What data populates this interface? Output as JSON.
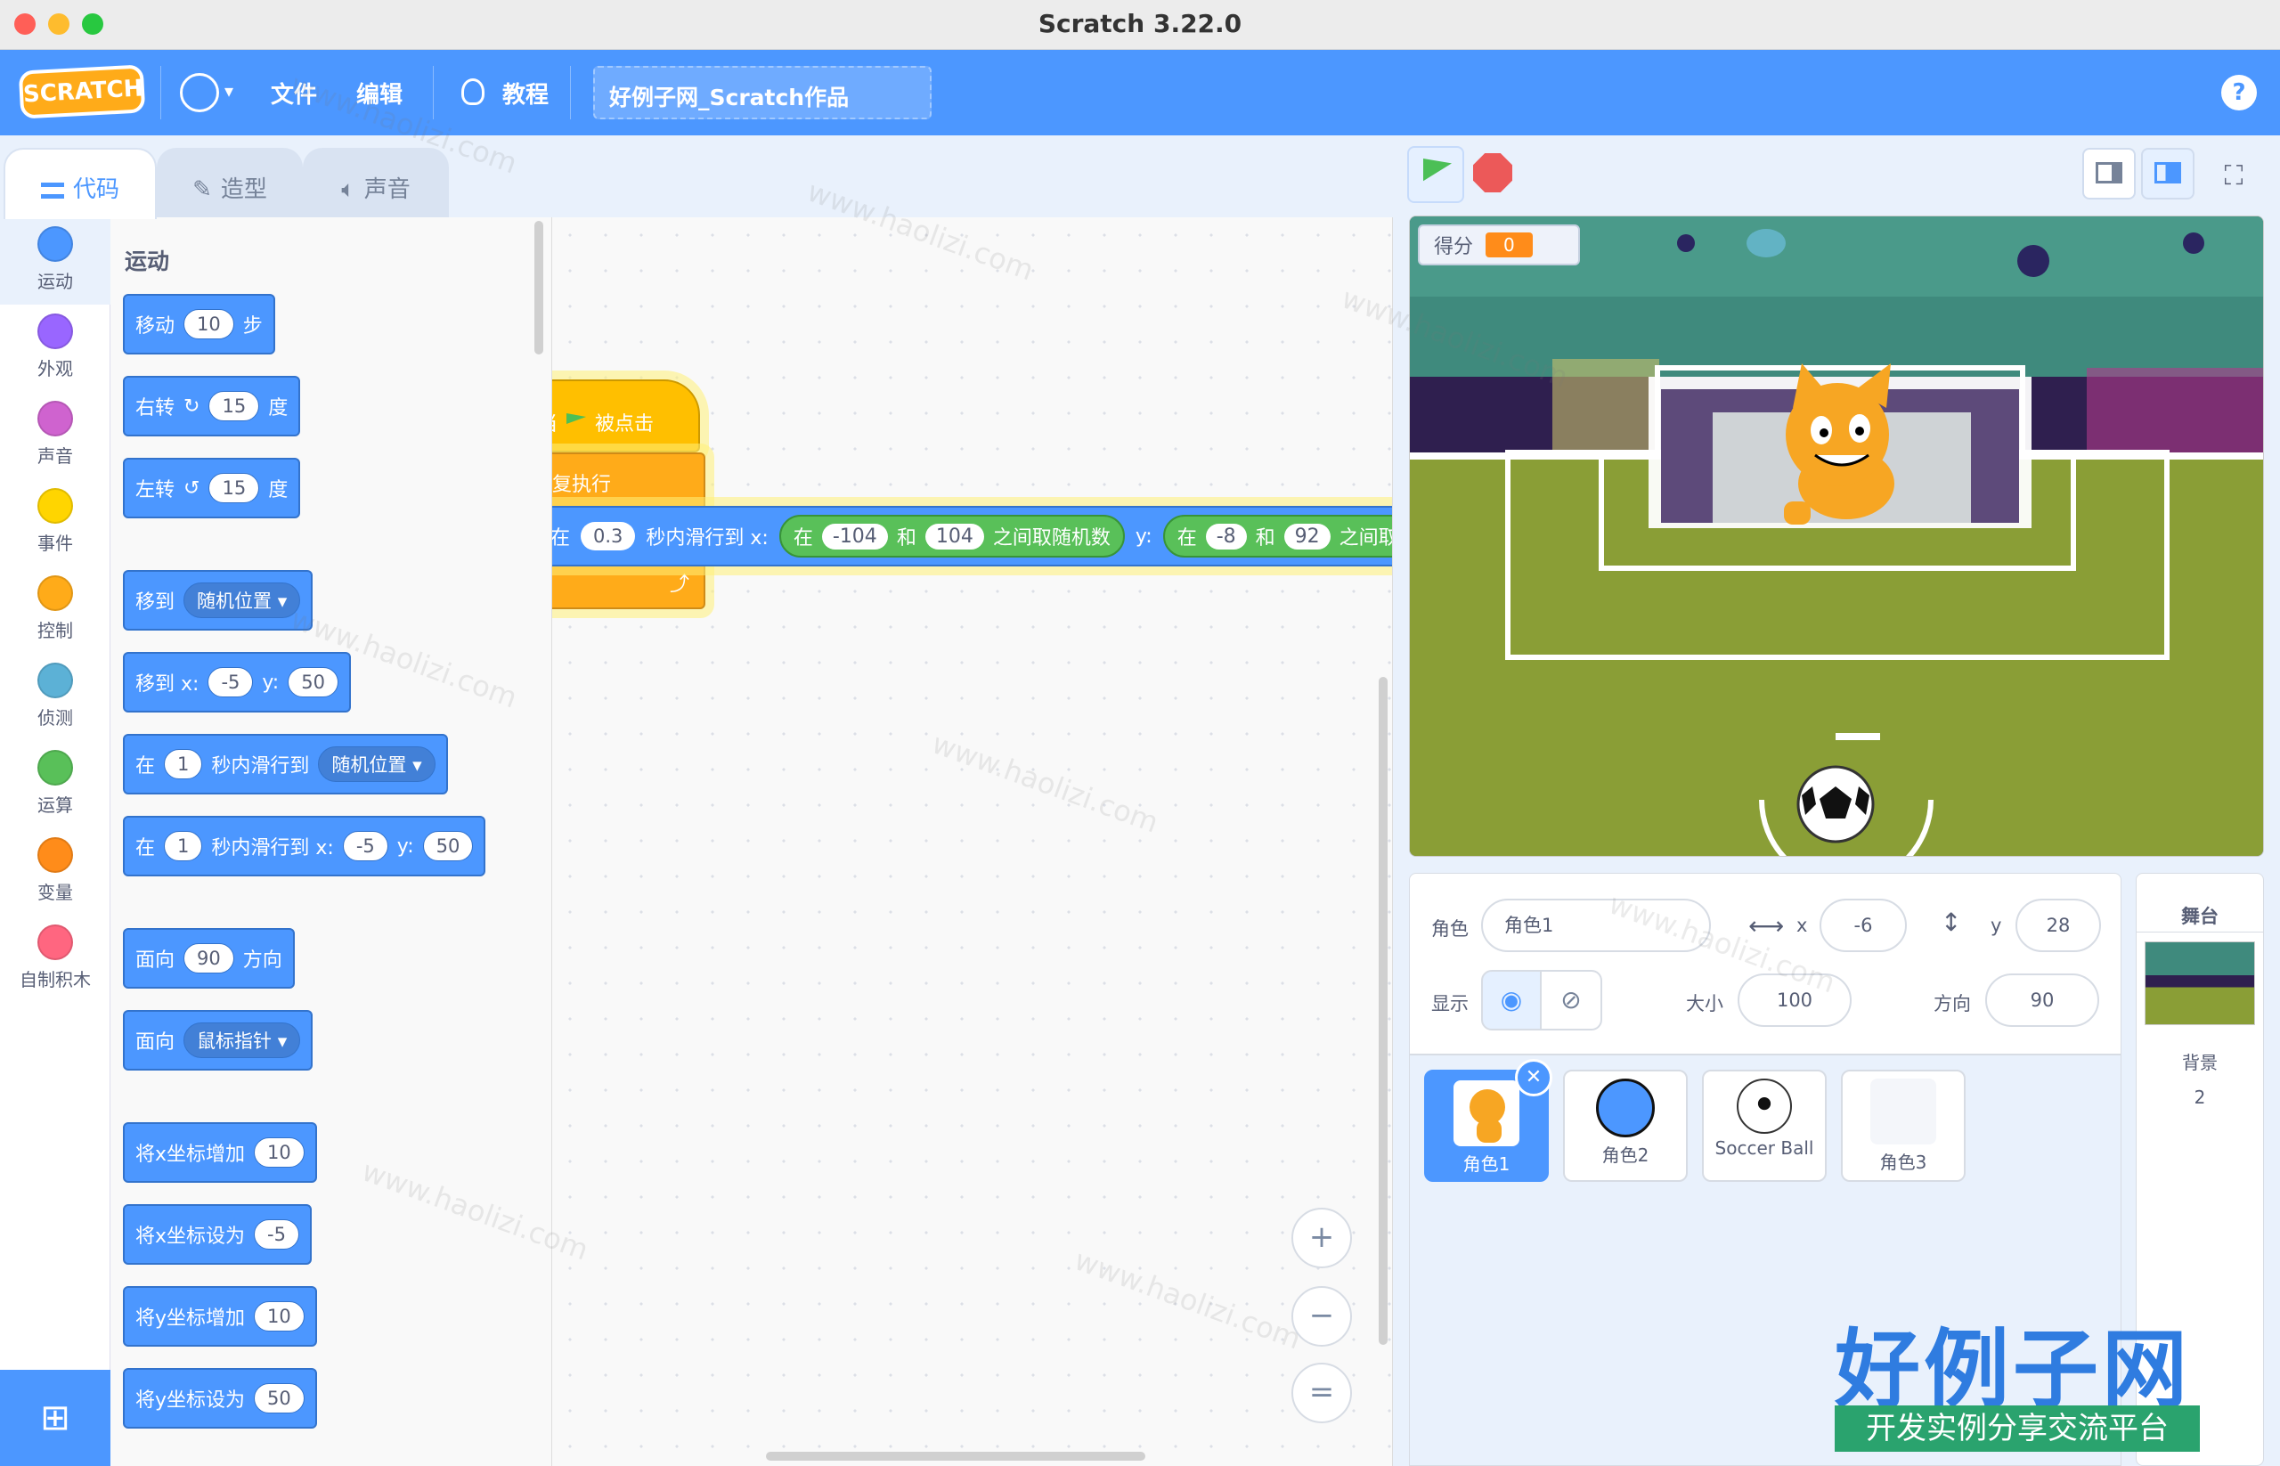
{
  "window": {
    "title": "Scratch 3.22.0"
  },
  "menubar": {
    "logo": "SCRATCH",
    "file": "文件",
    "edit": "编辑",
    "tutorials": "教程",
    "project_title": "好例子网_Scratch作品",
    "help": "?"
  },
  "tabs": {
    "code": "代码",
    "costumes": "造型",
    "sounds": "声音"
  },
  "categories": [
    {
      "label": "运动",
      "color": "#4c97ff"
    },
    {
      "label": "外观",
      "color": "#9966ff"
    },
    {
      "label": "声音",
      "color": "#cf63cf"
    },
    {
      "label": "事件",
      "color": "#ffd500"
    },
    {
      "label": "控制",
      "color": "#ffab19"
    },
    {
      "label": "侦测",
      "color": "#5cb1d6"
    },
    {
      "label": "运算",
      "color": "#59c059"
    },
    {
      "label": "变量",
      "color": "#ff8c1a"
    },
    {
      "label": "自制积木",
      "color": "#ff6680"
    }
  ],
  "palette": {
    "heading": "运动",
    "blocks": {
      "move": {
        "pre": "移动",
        "val": "10",
        "post": "步"
      },
      "turn_right": {
        "pre": "右转",
        "icon": "↻",
        "val": "15",
        "post": "度"
      },
      "turn_left": {
        "pre": "左转",
        "icon": "↺",
        "val": "15",
        "post": "度"
      },
      "goto": {
        "pre": "移到",
        "dd": "随机位置 ▾"
      },
      "goto_xy": {
        "pre": "移到 x:",
        "x": "-5",
        "ylabel": "y:",
        "y": "50"
      },
      "glide": {
        "pre": "在",
        "val": "1",
        "mid": "秒内滑行到",
        "dd": "随机位置 ▾"
      },
      "glide_xy": {
        "pre": "在",
        "val": "1",
        "mid": "秒内滑行到 x:",
        "x": "-5",
        "ylabel": "y:",
        "y": "50"
      },
      "point_dir": {
        "pre": "面向",
        "val": "90",
        "post": "方向"
      },
      "point_towards": {
        "pre": "面向",
        "dd": "鼠标指针 ▾"
      },
      "change_x": {
        "pre": "将x坐标增加",
        "val": "10"
      },
      "set_x": {
        "pre": "将x坐标设为",
        "val": "-5"
      },
      "change_y": {
        "pre": "将y坐标增加",
        "val": "10"
      },
      "set_y": {
        "pre": "将y坐标设为",
        "val": "50"
      }
    }
  },
  "script": {
    "hat_pre": "当",
    "hat_post": "被点击",
    "forever": "重复执行",
    "glide": {
      "pre": "在",
      "secs": "0.3",
      "mid": "秒内滑行到 x:",
      "r1_pre": "在",
      "r1_a": "-104",
      "r1_and": "和",
      "r1_b": "104",
      "r1_post": "之间取随机数",
      "ylabel": "y:",
      "r2_pre": "在",
      "r2_a": "-8",
      "r2_and": "和",
      "r2_b": "92",
      "r2_post": "之间取"
    }
  },
  "zoom": {
    "in": "+",
    "out": "−",
    "reset": "="
  },
  "stage": {
    "monitor_label": "得分",
    "monitor_value": "0"
  },
  "sprite_info": {
    "sprite_label": "角色",
    "sprite_name": "角色1",
    "x_label": "x",
    "x": "-6",
    "y_label": "y",
    "y": "28",
    "show_label": "显示",
    "size_label": "大小",
    "size": "100",
    "direction_label": "方向",
    "direction": "90"
  },
  "sprites": [
    {
      "name": "角色1",
      "selected": true
    },
    {
      "name": "角色2",
      "selected": false
    },
    {
      "name": "Soccer Ball",
      "selected": false
    },
    {
      "name": "角色3",
      "selected": false
    }
  ],
  "stage_pane": {
    "title": "舞台",
    "backdrops_label": "背景",
    "backdrops_count": "2"
  },
  "watermark": {
    "brand": "好例子网",
    "tagline": "开发实例分享交流平台",
    "repeat": "www.haolizi.com"
  },
  "colors": {
    "accent": "#4c97ff",
    "motion": "#4c97ff",
    "control": "#ffab19",
    "operators": "#59c059",
    "events": "#ffbf00"
  }
}
